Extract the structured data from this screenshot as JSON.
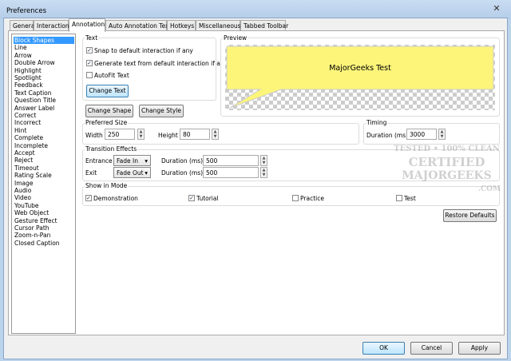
{
  "window": {
    "title": "Preferences",
    "close": "✕"
  },
  "tabs": [
    "General",
    "Interaction",
    "Annotation",
    "Auto Annotation Text",
    "Hotkeys",
    "Miscellaneous",
    "Tabbed Toolbar"
  ],
  "active_tab": "Annotation",
  "shape_list": [
    "Block Shapes",
    "Line",
    "Arrow",
    "Double Arrow",
    "Highlight",
    "Spotlight",
    "Feedback",
    "Text Caption",
    "Question Title",
    "Answer Label",
    "Correct",
    "Incorrect",
    "Hint",
    "Complete",
    "Incomplete",
    "Accept",
    "Reject",
    "Timeout",
    "Rating Scale",
    "Image",
    "Audio",
    "Video",
    "YouTube",
    "Web Object",
    "Gesture Effect",
    "Cursor Path",
    "Zoom-n-Pan",
    "Closed Caption"
  ],
  "selected_shape": "Block Shapes",
  "text_group": {
    "label": "Text",
    "snap": "Snap to default interaction if any",
    "snap_checked": true,
    "generate": "Generate text from default interaction if any",
    "generate_checked": true,
    "autofit": "AutoFit Text",
    "autofit_checked": false,
    "change_text": "Change Text"
  },
  "buttons": {
    "change_shape": "Change Shape",
    "change_style": "Change Style",
    "restore": "Restore Defaults",
    "ok": "OK",
    "cancel": "Cancel",
    "apply": "Apply"
  },
  "preview": {
    "label": "Preview",
    "text": "MajorGeeks Test",
    "fill": "#fdf57a"
  },
  "size": {
    "label": "Preferred Size",
    "width_label": "Width",
    "width": "250",
    "height_label": "Height",
    "height": "80"
  },
  "timing": {
    "label": "Timing",
    "duration_label": "Duration (ms)",
    "duration": "3000"
  },
  "transition": {
    "label": "Transition Effects",
    "entrance_label": "Entrance",
    "entrance": "Fade In",
    "exit_label": "Exit",
    "exit": "Fade Out",
    "duration_label": "Duration (ms)",
    "entrance_duration": "500",
    "exit_duration": "500"
  },
  "mode": {
    "label": "Show in Mode",
    "demonstration": "Demonstration",
    "tutorial": "Tutorial",
    "practice": "Practice",
    "test": "Test",
    "checked": {
      "demonstration": true,
      "tutorial": true,
      "practice": false,
      "test": false
    }
  },
  "watermark": [
    "TESTED • 100% CLEAN",
    "CERTIFIED",
    "MAJORGEEKS",
    ".COM"
  ]
}
